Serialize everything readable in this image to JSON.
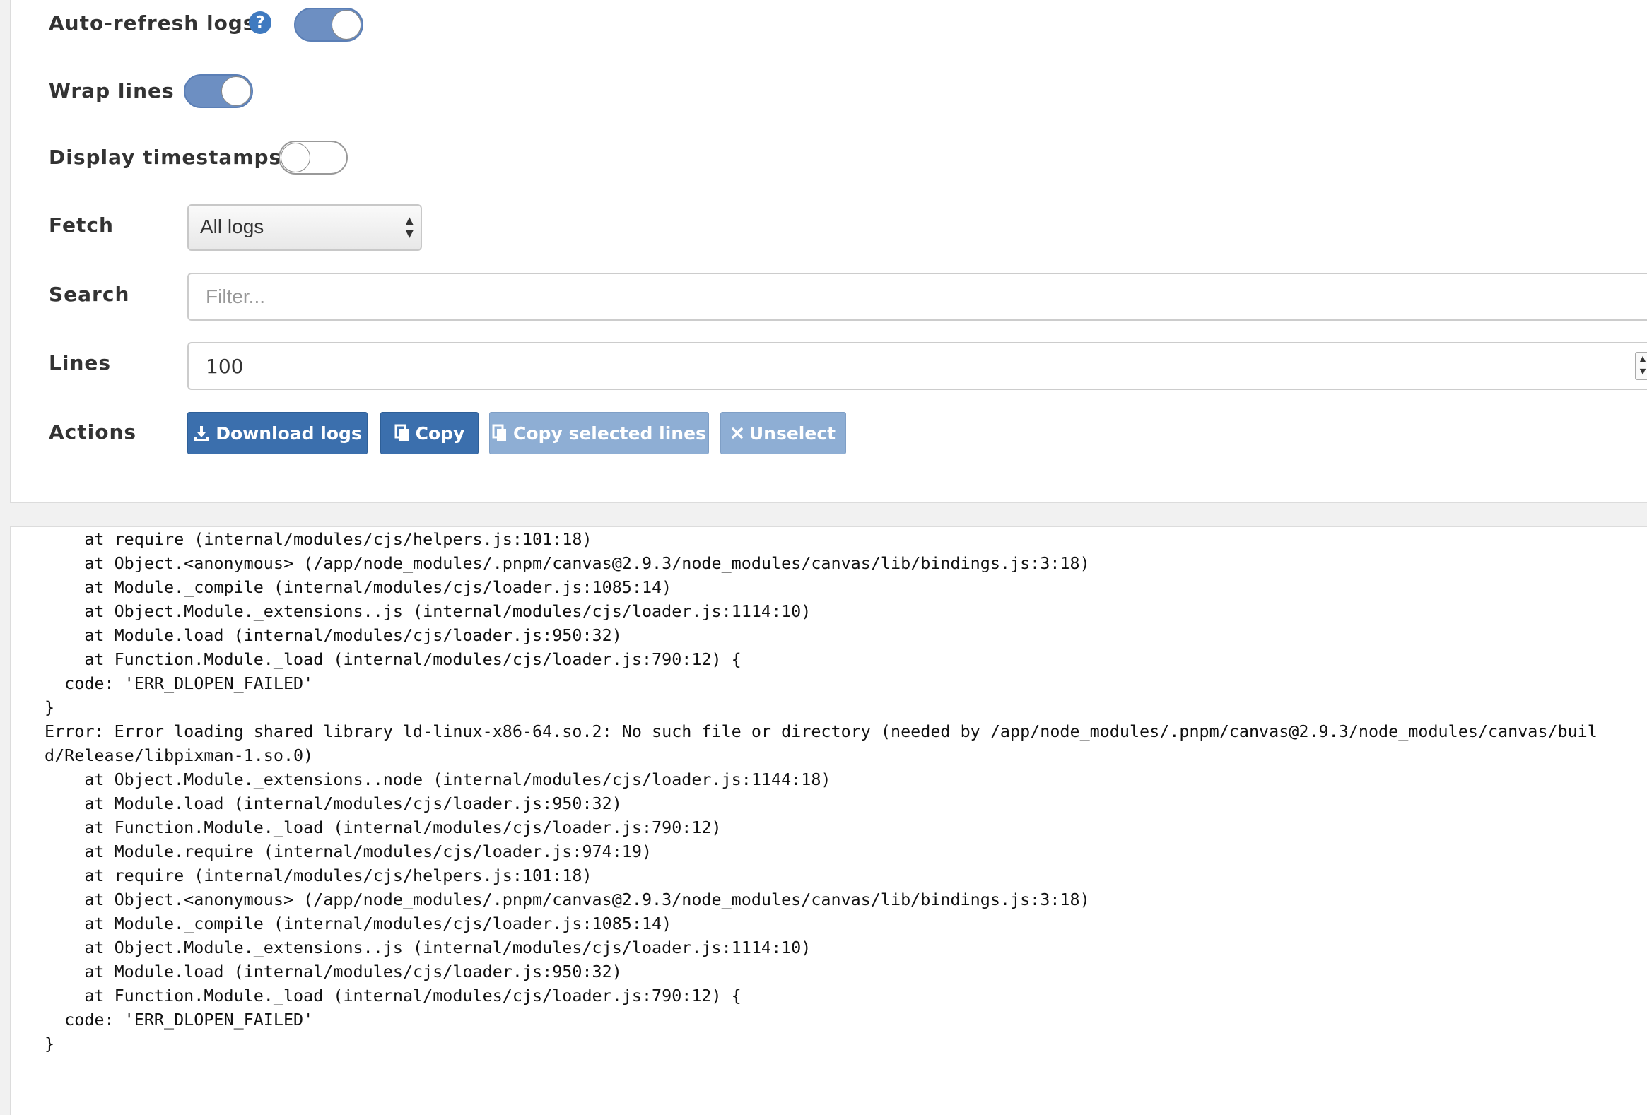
{
  "settings": {
    "auto_refresh": {
      "label": "Auto-refresh logs",
      "help_glyph": "?",
      "enabled": true
    },
    "wrap_lines": {
      "label": "Wrap lines",
      "enabled": true
    },
    "display_timestamps": {
      "label": "Display timestamps",
      "enabled": false
    },
    "fetch": {
      "label": "Fetch",
      "selected": "All logs"
    },
    "search": {
      "label": "Search",
      "placeholder": "Filter...",
      "value": ""
    },
    "lines": {
      "label": "Lines",
      "value": "100"
    },
    "actions": {
      "label": "Actions",
      "download": "Download logs",
      "copy": "Copy",
      "copy_selected": "Copy selected lines",
      "unselect": "Unselect"
    }
  },
  "colors": {
    "primary": "#3b6fad",
    "disabled": "#8eaed4",
    "toggle_on": "#6d8fc2",
    "help": "#3f7ac0"
  },
  "icons": {
    "help": "question-circle-icon",
    "download": "download-icon",
    "copy": "copy-icon",
    "copy_selected": "copy-icon",
    "unselect": "close-icon"
  },
  "log_lines": [
    "    at require (internal/modules/cjs/helpers.js:101:18)",
    "    at Object.<anonymous> (/app/node_modules/.pnpm/canvas@2.9.3/node_modules/canvas/lib/bindings.js:3:18)",
    "    at Module._compile (internal/modules/cjs/loader.js:1085:14)",
    "    at Object.Module._extensions..js (internal/modules/cjs/loader.js:1114:10)",
    "    at Module.load (internal/modules/cjs/loader.js:950:32)",
    "    at Function.Module._load (internal/modules/cjs/loader.js:790:12) {",
    "  code: 'ERR_DLOPEN_FAILED'",
    "}",
    "Error: Error loading shared library ld-linux-x86-64.so.2: No such file or directory (needed by /app/node_modules/.pnpm/canvas@2.9.3/node_modules/canvas/buil",
    "d/Release/libpixman-1.so.0)",
    "    at Object.Module._extensions..node (internal/modules/cjs/loader.js:1144:18)",
    "    at Module.load (internal/modules/cjs/loader.js:950:32)",
    "    at Function.Module._load (internal/modules/cjs/loader.js:790:12)",
    "    at Module.require (internal/modules/cjs/loader.js:974:19)",
    "    at require (internal/modules/cjs/helpers.js:101:18)",
    "    at Object.<anonymous> (/app/node_modules/.pnpm/canvas@2.9.3/node_modules/canvas/lib/bindings.js:3:18)",
    "    at Module._compile (internal/modules/cjs/loader.js:1085:14)",
    "    at Object.Module._extensions..js (internal/modules/cjs/loader.js:1114:10)",
    "    at Module.load (internal/modules/cjs/loader.js:950:32)",
    "    at Function.Module._load (internal/modules/cjs/loader.js:790:12) {",
    "  code: 'ERR_DLOPEN_FAILED'",
    "}"
  ]
}
